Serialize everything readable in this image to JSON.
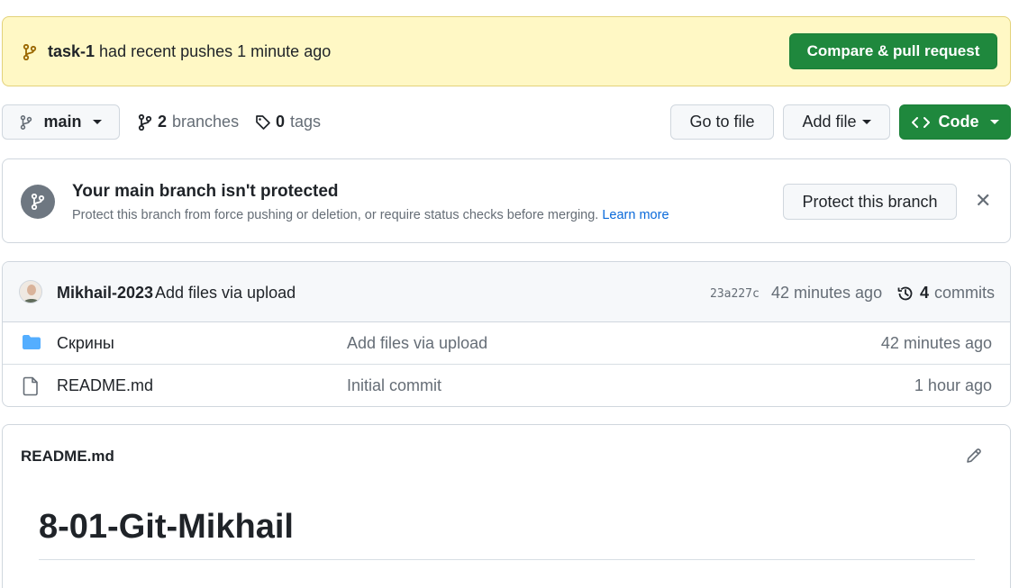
{
  "push_banner": {
    "branch": "task-1",
    "text": "had recent pushes 1 minute ago",
    "button": "Compare & pull request"
  },
  "toolbar": {
    "branch": "main",
    "branches_count": "2",
    "branches_label": "branches",
    "tags_count": "0",
    "tags_label": "tags",
    "goto_file": "Go to file",
    "add_file": "Add file",
    "code": "Code"
  },
  "protect": {
    "title": "Your main branch isn't protected",
    "description": "Protect this branch from force pushing or deletion, or require status checks before merging.",
    "learn_more": "Learn more",
    "button": "Protect this branch"
  },
  "latest_commit": {
    "author": "Mikhail-2023",
    "message": "Add files via upload",
    "sha": "23a227c",
    "time": "42 minutes ago",
    "commits_count": "4",
    "commits_label": "commits"
  },
  "files": [
    {
      "name": "Скрины",
      "type": "folder",
      "message": "Add files via upload",
      "time": "42 minutes ago"
    },
    {
      "name": "README.md",
      "type": "file",
      "message": "Initial commit",
      "time": "1 hour ago"
    }
  ],
  "readme": {
    "filename": "README.md",
    "heading": "8-01-Git-Mikhail"
  },
  "colors": {
    "green": "#1f883d",
    "banner_yellow": "#fff8c5",
    "link_blue": "#0969da",
    "folder_blue": "#54aeff"
  }
}
